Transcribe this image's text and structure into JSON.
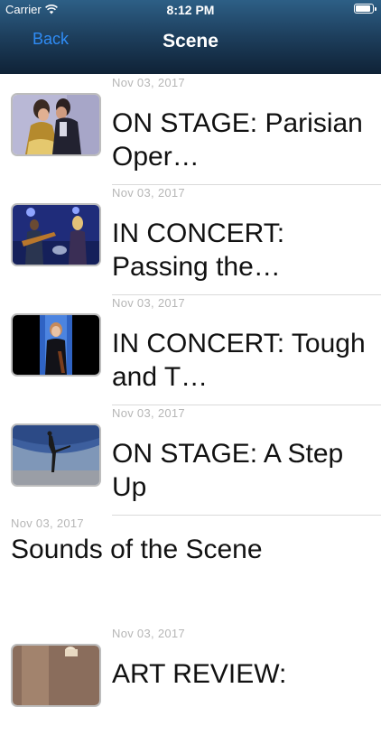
{
  "status_bar": {
    "carrier": "Carrier",
    "time": "8:12 PM",
    "battery_level": 0.9
  },
  "nav": {
    "back_label": "Back",
    "title": "Scene"
  },
  "articles": [
    {
      "date": "Nov  03, 2017",
      "title": "ON STAGE: Parisian Oper…",
      "has_thumbnail": true
    },
    {
      "date": "Nov  03, 2017",
      "title": "IN CONCERT: Passing the…",
      "has_thumbnail": true
    },
    {
      "date": "Nov  03, 2017",
      "title": "IN CONCERT: Tough and T…",
      "has_thumbnail": true
    },
    {
      "date": "Nov  03, 2017",
      "title": "ON STAGE: A Step Up",
      "has_thumbnail": true
    },
    {
      "date": "Nov  03, 2017",
      "title": "Sounds of the Scene",
      "has_thumbnail": false
    },
    {
      "date": "Nov  03, 2017",
      "title": "ART REVIEW:",
      "has_thumbnail": true
    }
  ]
}
